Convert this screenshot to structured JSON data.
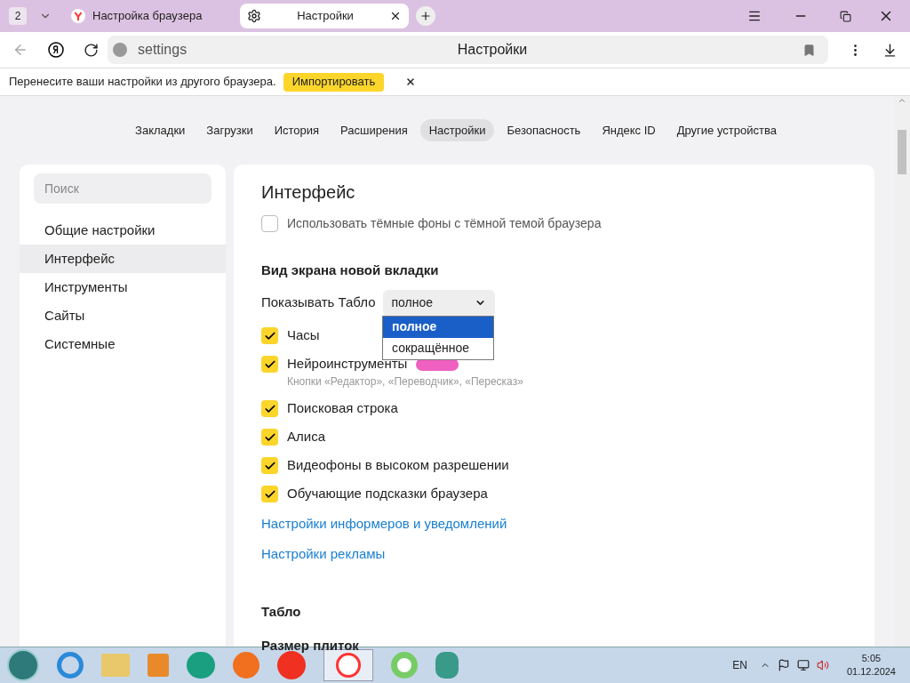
{
  "tab_strip": {
    "tab_count": "2",
    "tabs": [
      {
        "title": "Настройка браузера",
        "selected": false,
        "kind": "yandex"
      },
      {
        "title": "Настройки",
        "selected": true,
        "kind": "settings"
      }
    ]
  },
  "address_bar": {
    "url": "settings",
    "page_title": "Настройки"
  },
  "infobar": {
    "text": "Перенесите ваши настройки из другого браузера.",
    "button": "Импортировать"
  },
  "nav": [
    {
      "label": "Закладки",
      "selected": false
    },
    {
      "label": "Загрузки",
      "selected": false
    },
    {
      "label": "История",
      "selected": false
    },
    {
      "label": "Расширения",
      "selected": false
    },
    {
      "label": "Настройки",
      "selected": true
    },
    {
      "label": "Безопасность",
      "selected": false
    },
    {
      "label": "Яндекс ID",
      "selected": false
    },
    {
      "label": "Другие устройства",
      "selected": false
    }
  ],
  "sidebar": {
    "search_placeholder": "Поиск",
    "items": [
      {
        "label": "Общие настройки",
        "selected": false
      },
      {
        "label": "Интерфейс",
        "selected": true
      },
      {
        "label": "Инструменты",
        "selected": false
      },
      {
        "label": "Сайты",
        "selected": false
      },
      {
        "label": "Системные",
        "selected": false
      }
    ]
  },
  "main": {
    "title": "Интерфейс",
    "top_option": {
      "label": "Использовать тёмные фоны с тёмной темой браузера",
      "checked": false
    },
    "section": "Вид экрана новой вкладки",
    "select_label": "Показывать Табло",
    "select_value": "полное",
    "dropdown": [
      {
        "label": "полное",
        "selected": true
      },
      {
        "label": "сокращённое",
        "selected": false
      }
    ],
    "options": [
      {
        "label": "Часы",
        "checked": true
      },
      {
        "label": "Нейроинструменты",
        "checked": true,
        "badge": true,
        "hint": "Кнопки «Редактор», «Переводчик», «Пересказ»"
      },
      {
        "label": "Поисковая строка",
        "checked": true
      },
      {
        "label": "Алиса",
        "checked": true
      },
      {
        "label": "Видеофоны в высоком разрешении",
        "checked": true
      },
      {
        "label": "Обучающие подсказки браузера",
        "checked": true
      }
    ],
    "links": [
      "Настройки информеров и уведомлений",
      "Настройки рекламы"
    ],
    "section2": "Табло",
    "subsection": "Размер плиток"
  },
  "taskbar": {
    "language": "EN",
    "time": "5:05",
    "date": "01.12.2024"
  }
}
